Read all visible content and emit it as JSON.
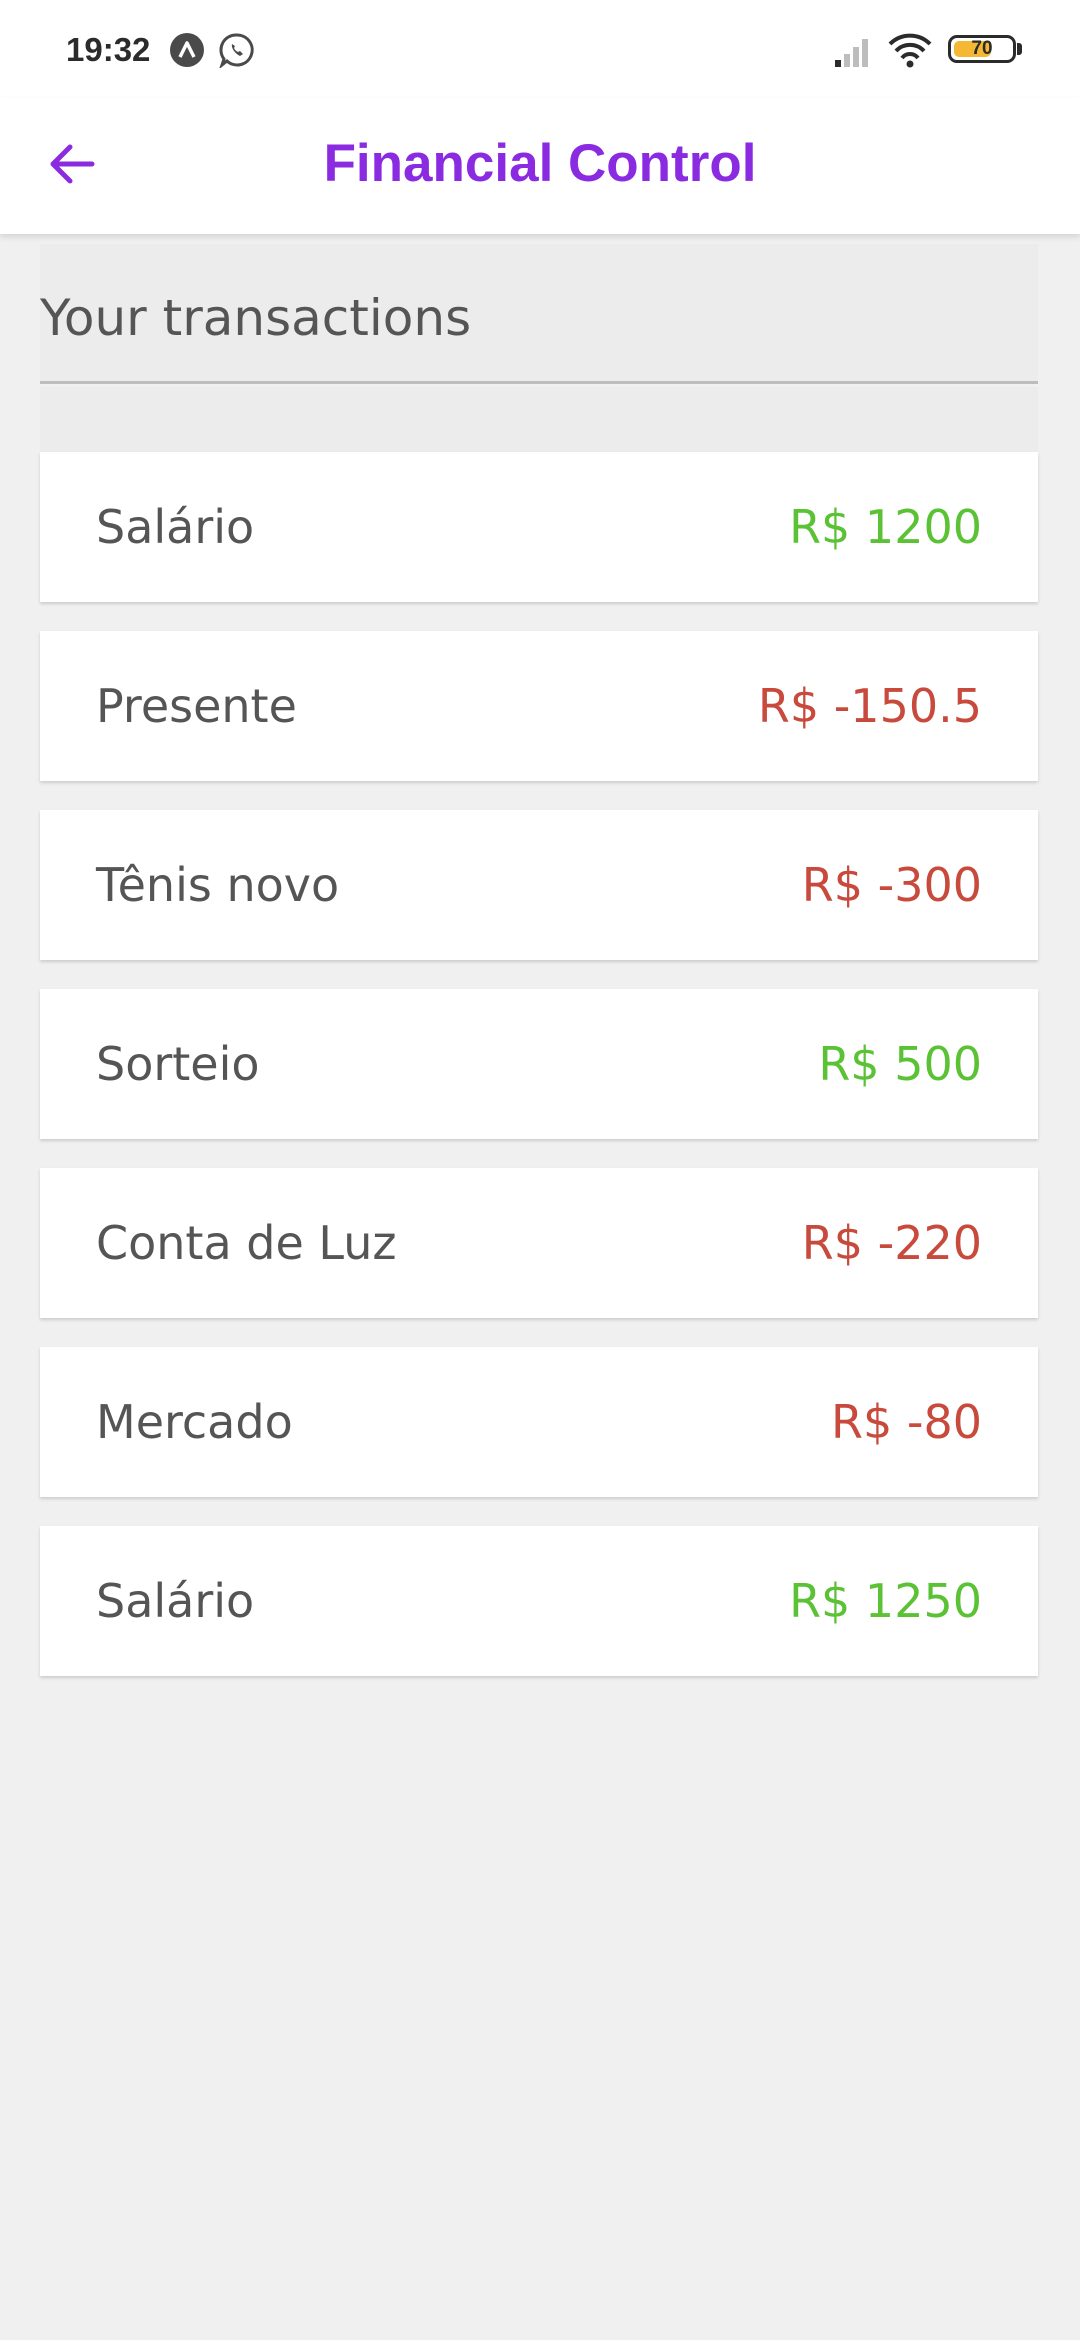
{
  "status_bar": {
    "time": "19:32",
    "battery_level": "70",
    "battery_fraction": 0.7,
    "icons": [
      "app-a-icon",
      "whatsapp-icon",
      "signal-icon",
      "wifi-icon",
      "battery-icon"
    ]
  },
  "app_bar": {
    "title": "Financial Control",
    "back_icon": "arrow-left-icon",
    "title_color": "#8a2be2"
  },
  "section": {
    "title": "Your transactions"
  },
  "colors": {
    "positive": "#5bc236",
    "negative": "#c84a3c",
    "text": "#555555"
  },
  "transactions": [
    {
      "name": "Salário",
      "amount": "R$ 1200",
      "type": "positive"
    },
    {
      "name": "Presente",
      "amount": "R$ -150.5",
      "type": "negative"
    },
    {
      "name": "Tênis novo",
      "amount": "R$ -300",
      "type": "negative"
    },
    {
      "name": "Sorteio",
      "amount": "R$ 500",
      "type": "positive"
    },
    {
      "name": "Conta de Luz",
      "amount": "R$ -220",
      "type": "negative"
    },
    {
      "name": "Mercado",
      "amount": "R$ -80",
      "type": "negative"
    },
    {
      "name": "Salário",
      "amount": "R$ 1250",
      "type": "positive"
    }
  ]
}
